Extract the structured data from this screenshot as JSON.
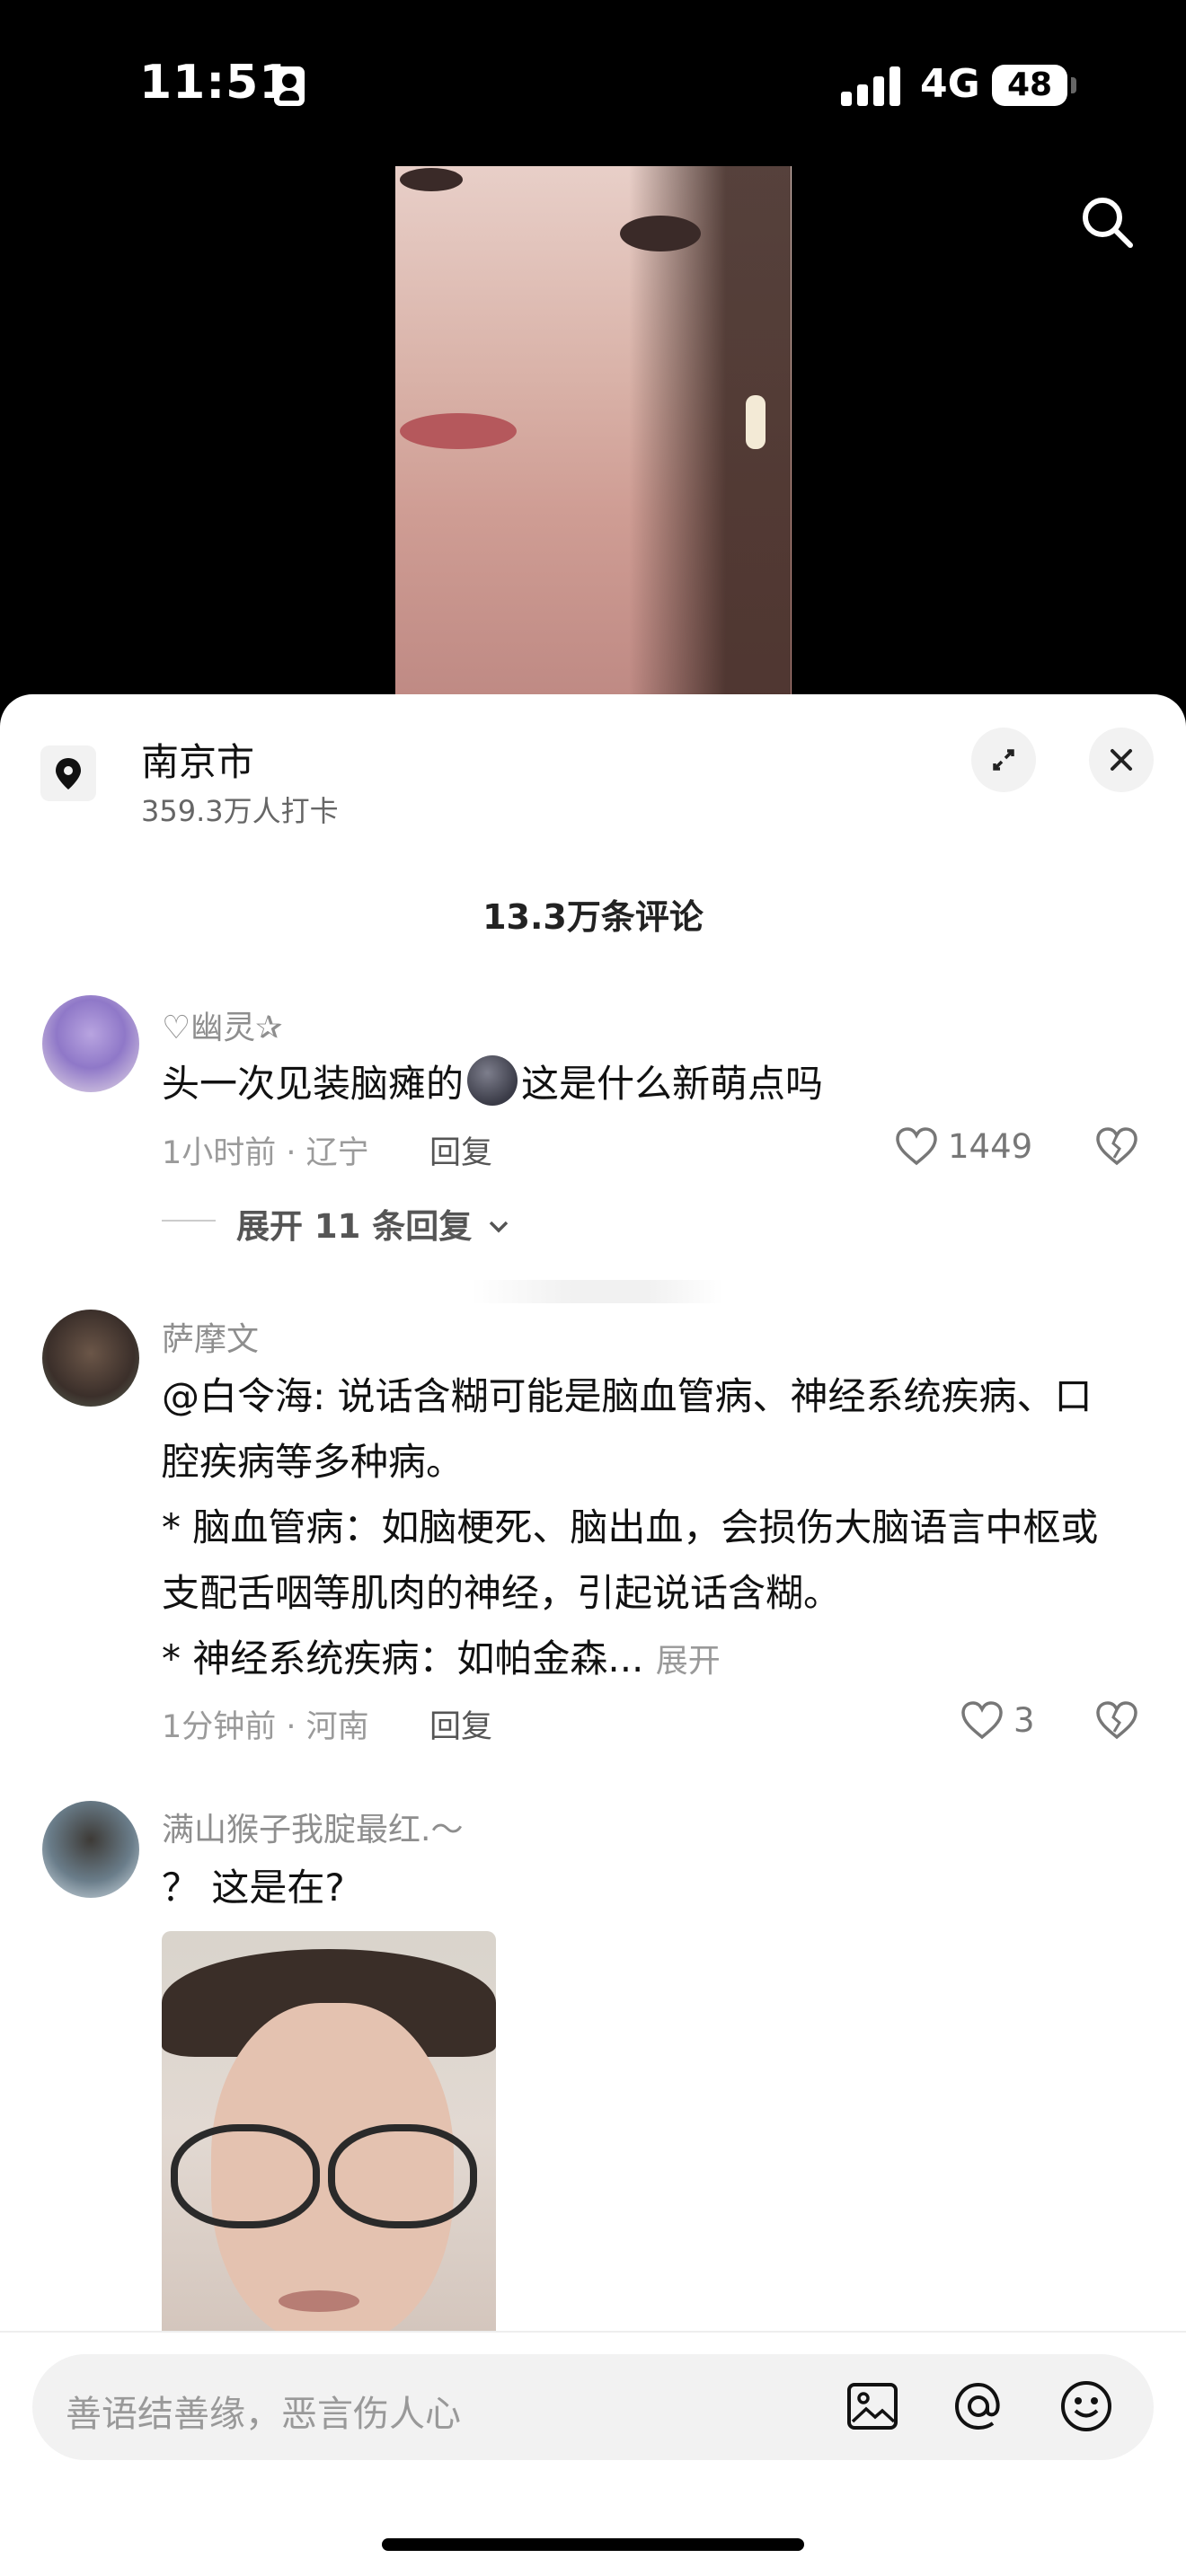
{
  "status_bar": {
    "time": "11:51",
    "network": "4G",
    "battery": "48"
  },
  "location": {
    "name": "南京市",
    "checkins": "359.3万人打卡"
  },
  "comments_count": "13.3万条评论",
  "comments": [
    {
      "username": "♡幽灵✰",
      "text_before": "头一次见装脑瘫的",
      "text_after": "这是什么新萌点吗",
      "meta": "1小时前 · 辽宁",
      "reply_label": "回复",
      "likes": "1449",
      "expand_replies": "展开 11 条回复"
    },
    {
      "username": "萨摩文",
      "lines": [
        "@白令海: 说话含糊可能是脑血管病、神经系统疾病、口",
        "腔疾病等多种病。",
        "* 脑血管病：如脑梗死、脑出血，会损伤大脑语言中枢或",
        "支配舌咽等肌肉的神经，引起说话含糊。",
        "* 神经系统疾病：如帕金森..."
      ],
      "expand_label": "展开",
      "meta": "1分钟前 · 河南",
      "reply_label": "回复",
      "likes": "3"
    },
    {
      "username": "满山猴子我腚最红.～",
      "text": "？ 这是在?"
    }
  ],
  "input": {
    "placeholder": "善语结善缘，恶言伤人心"
  },
  "icons": {
    "search": "search-icon",
    "location": "location-pin-icon",
    "expand": "expand-icon",
    "close": "close-icon",
    "like": "heart-icon",
    "dislike": "broken-heart-icon",
    "image": "image-icon",
    "mention": "at-icon",
    "emoji": "emoji-icon"
  }
}
